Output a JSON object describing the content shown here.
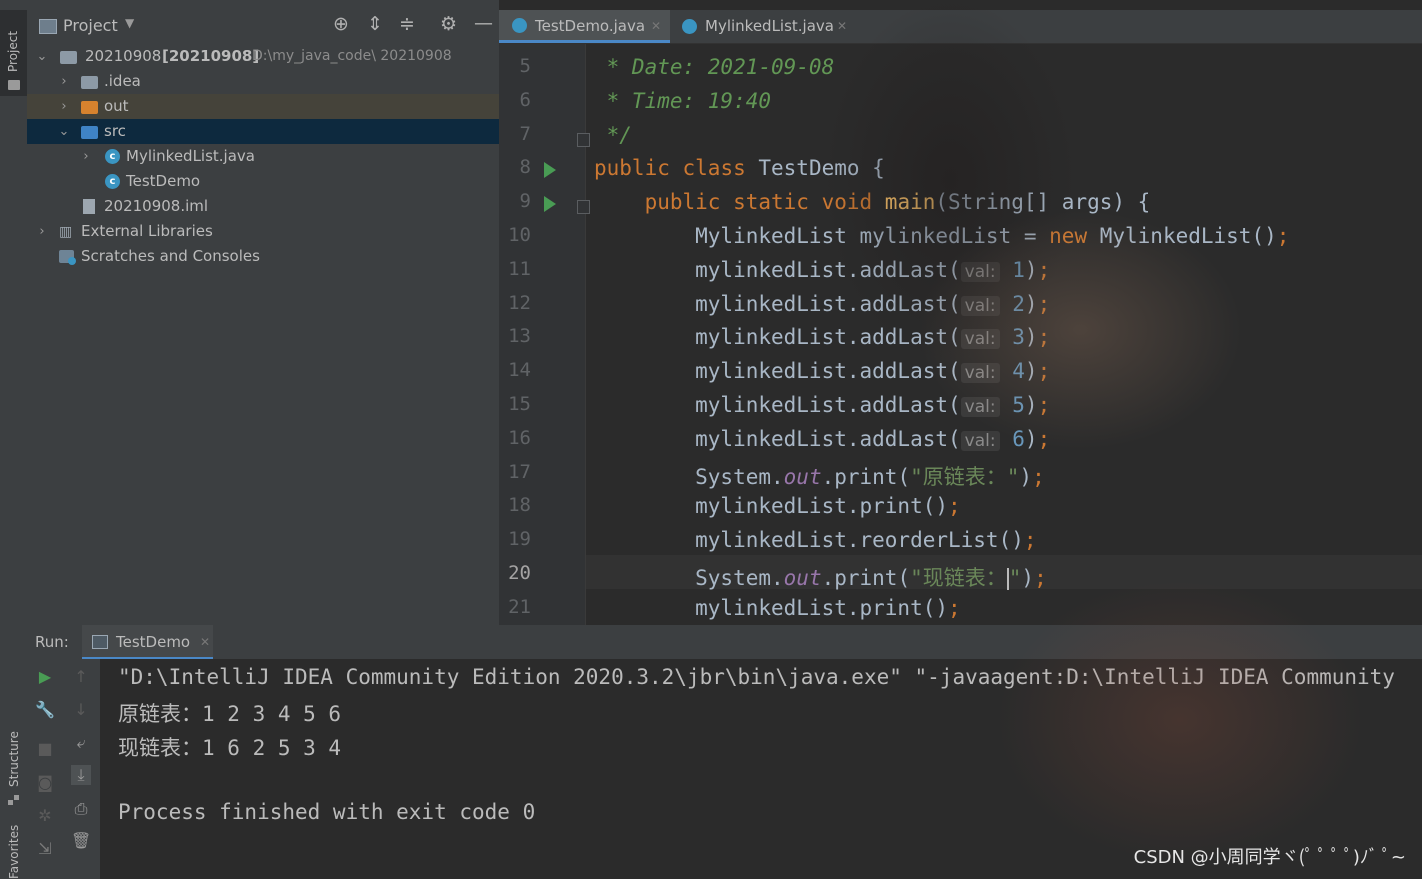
{
  "left_strip": {
    "project_label": "Project",
    "structure_label": "Structure",
    "favorites_label": "Favorites"
  },
  "project_panel": {
    "title": "Project",
    "tree": [
      {
        "name": "20210908",
        "bold_suffix": "[20210908]",
        "path": "D:\\my_java_code\\ 20210908"
      },
      {
        "name": ".idea"
      },
      {
        "name": "out"
      },
      {
        "name": "src"
      },
      {
        "name": "MylinkedList.java"
      },
      {
        "name": "TestDemo"
      },
      {
        "name": "20210908.iml"
      },
      {
        "name": "External Libraries"
      },
      {
        "name": "Scratches and Consoles"
      }
    ]
  },
  "editor": {
    "tabs": [
      {
        "label": "TestDemo.java"
      },
      {
        "label": "MylinkedList.java"
      }
    ],
    "current_line": "20",
    "lines": [
      {
        "n": "5",
        "text": " * Date: 2021-09-08"
      },
      {
        "n": "6",
        "text": " * Time: 19:40"
      },
      {
        "n": "7",
        "text": " */"
      },
      {
        "n": "8",
        "kw1": "public ",
        "kw2": "class ",
        "text": "TestDemo {"
      },
      {
        "n": "9",
        "kw1": "    public ",
        "kw2": "static void ",
        "fn": "main",
        "text": "(String[] args) {"
      },
      {
        "n": "10",
        "text": "        MylinkedList mylinkedList = ",
        "kw": "new ",
        "text2": "MylinkedList()",
        "semi": ";"
      },
      {
        "n": "11",
        "text": "        mylinkedList.addLast(",
        "hint": "val:",
        "num": "1",
        "close": ")",
        "semi": ";"
      },
      {
        "n": "12",
        "text": "        mylinkedList.addLast(",
        "hint": "val:",
        "num": "2",
        "close": ")",
        "semi": ";"
      },
      {
        "n": "13",
        "text": "        mylinkedList.addLast(",
        "hint": "val:",
        "num": "3",
        "close": ")",
        "semi": ";"
      },
      {
        "n": "14",
        "text": "        mylinkedList.addLast(",
        "hint": "val:",
        "num": "4",
        "close": ")",
        "semi": ";"
      },
      {
        "n": "15",
        "text": "        mylinkedList.addLast(",
        "hint": "val:",
        "num": "5",
        "close": ")",
        "semi": ";"
      },
      {
        "n": "16",
        "text": "        mylinkedList.addLast(",
        "hint": "val:",
        "num": "6",
        "close": ")",
        "semi": ";"
      },
      {
        "n": "17",
        "text": "        System.",
        "field": "out",
        "text2": ".print(",
        "str": "\"原链表：\"",
        "close": ")",
        "semi": ";"
      },
      {
        "n": "18",
        "text": "        mylinkedList.print()",
        "semi": ";"
      },
      {
        "n": "19",
        "text": "        mylinkedList.reorderList()",
        "semi": ";"
      },
      {
        "n": "20",
        "text": "        System.",
        "field": "out",
        "text2": ".print(",
        "str": "\"现链表：",
        "str2": "\"",
        "close": ")",
        "semi": ";"
      },
      {
        "n": "21",
        "text": "        mylinkedList.print()",
        "semi": ";"
      }
    ]
  },
  "run_panel": {
    "label": "Run:",
    "tab": "TestDemo",
    "console": [
      "\"D:\\IntelliJ IDEA Community Edition 2020.3.2\\jbr\\bin\\java.exe\" \"-javaagent:D:\\IntelliJ IDEA Community",
      "原链表：1 2 3 4 5 6",
      "现链表：1 6 2 5 3 4",
      "",
      "Process finished with exit code 0"
    ]
  },
  "watermark": "CSDN @小周同学ヾ(ﾟ ﾟ ﾟ ﾟ)ﾉﾞ ﾟ~"
}
